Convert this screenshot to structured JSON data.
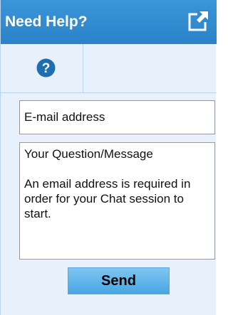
{
  "header": {
    "title": "Need Help?",
    "popout_icon": "popout-window-icon"
  },
  "tabs": {
    "help_icon": "question-mark-icon"
  },
  "form": {
    "email_placeholder": "E-mail address",
    "message_placeholder": "Your Question/Message\n\nAn email address is required in order for your Chat session to start.",
    "send_label": "Send"
  },
  "colors": {
    "header_bg": "#2e89cf",
    "panel_bg": "#e8f1fb",
    "button_bg": "#5bb3ea",
    "help_icon": "#1f6fb0"
  }
}
